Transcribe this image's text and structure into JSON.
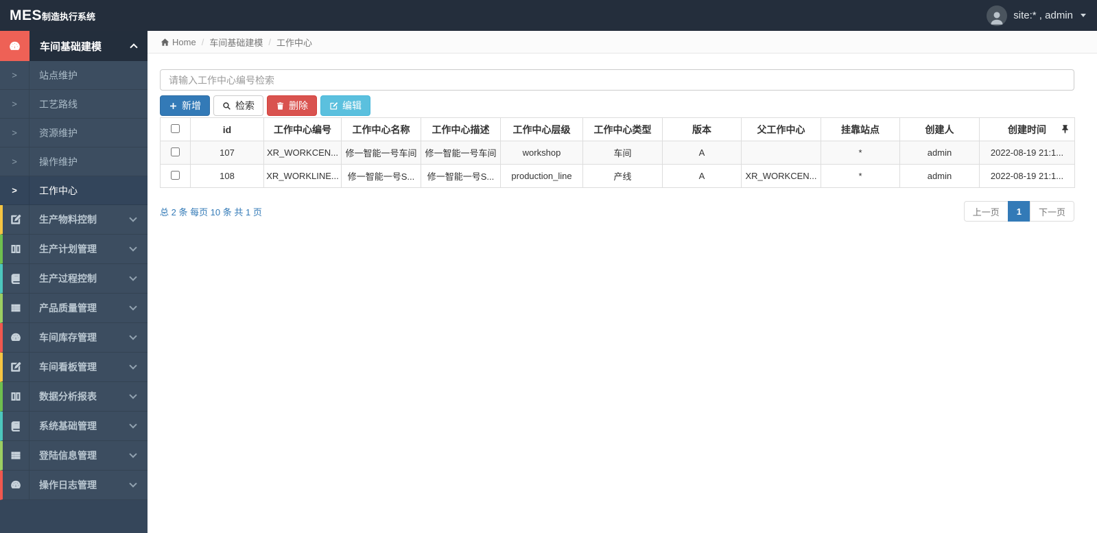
{
  "topbar": {
    "logo_bold": "MES",
    "logo_rest": "制造执行系统",
    "user": "site:* , admin"
  },
  "breadcrumb": {
    "home": "Home",
    "separator": "/",
    "level1": "车间基础建模",
    "current": "工作中心"
  },
  "sidebar": {
    "active_item": {
      "label": "车间基础建模",
      "icon": "gauge-icon",
      "accent": "#ee6156"
    },
    "submenu": [
      {
        "label": "站点维护",
        "active": false
      },
      {
        "label": "工艺路线",
        "active": false
      },
      {
        "label": "资源维护",
        "active": false
      },
      {
        "label": "操作维护",
        "active": false
      },
      {
        "label": "工作中心",
        "active": true
      }
    ],
    "items": [
      {
        "label": "生产物料控制",
        "icon": "pencil-square-icon",
        "accent": "#f5c542"
      },
      {
        "label": "生产计划管理",
        "icon": "columns-icon",
        "accent": "#6fbf4f"
      },
      {
        "label": "生产过程控制",
        "icon": "book-icon",
        "accent": "#4cc7bd"
      },
      {
        "label": "产品质量管理",
        "icon": "th-list-icon",
        "accent": "#9ccf62"
      },
      {
        "label": "车间库存管理",
        "icon": "gauge-icon",
        "accent": "#f0584f"
      },
      {
        "label": "车间看板管理",
        "icon": "pencil-square-icon",
        "accent": "#f5c542"
      },
      {
        "label": "数据分析报表",
        "icon": "columns-icon",
        "accent": "#6fbf4f"
      },
      {
        "label": "系统基础管理",
        "icon": "book-icon",
        "accent": "#4cc7bd"
      },
      {
        "label": "登陆信息管理",
        "icon": "th-list-icon",
        "accent": "#9ccf62"
      },
      {
        "label": "操作日志管理",
        "icon": "gauge-icon",
        "accent": "#f0584f"
      }
    ]
  },
  "toolbar": {
    "search_placeholder": "请输入工作中心编号检索",
    "add_label": "新增",
    "search_label": "检索",
    "delete_label": "删除",
    "edit_label": "编辑"
  },
  "table": {
    "columns": [
      "id",
      "工作中心编号",
      "工作中心名称",
      "工作中心描述",
      "工作中心层级",
      "工作中心类型",
      "版本",
      "父工作中心",
      "挂靠站点",
      "创建人",
      "创建时间"
    ],
    "rows": [
      [
        "107",
        "XR_WORKCEN...",
        "修一智能一号车间",
        "修一智能一号车间",
        "workshop",
        "车间",
        "A",
        "",
        "*",
        "admin",
        "2022-08-19 21:1..."
      ],
      [
        "108",
        "XR_WORKLINE...",
        "修一智能一号S...",
        "修一智能一号S...",
        "production_line",
        "产线",
        "A",
        "XR_WORKCEN...",
        "*",
        "admin",
        "2022-08-19 21:1..."
      ]
    ]
  },
  "pagination": {
    "summary": "总 2 条 每页 10 条 共 1 页",
    "prev_label": "上一页",
    "page": "1",
    "next_label": "下一页"
  },
  "colors": {
    "topbar": "#242e3c",
    "sidebar": "#35465a",
    "sidebar_row": "#3c4d60",
    "active_red": "#ee6156",
    "primary_blue": "#337ab7",
    "danger_red": "#d9534f",
    "info_cyan": "#5bc0de"
  }
}
